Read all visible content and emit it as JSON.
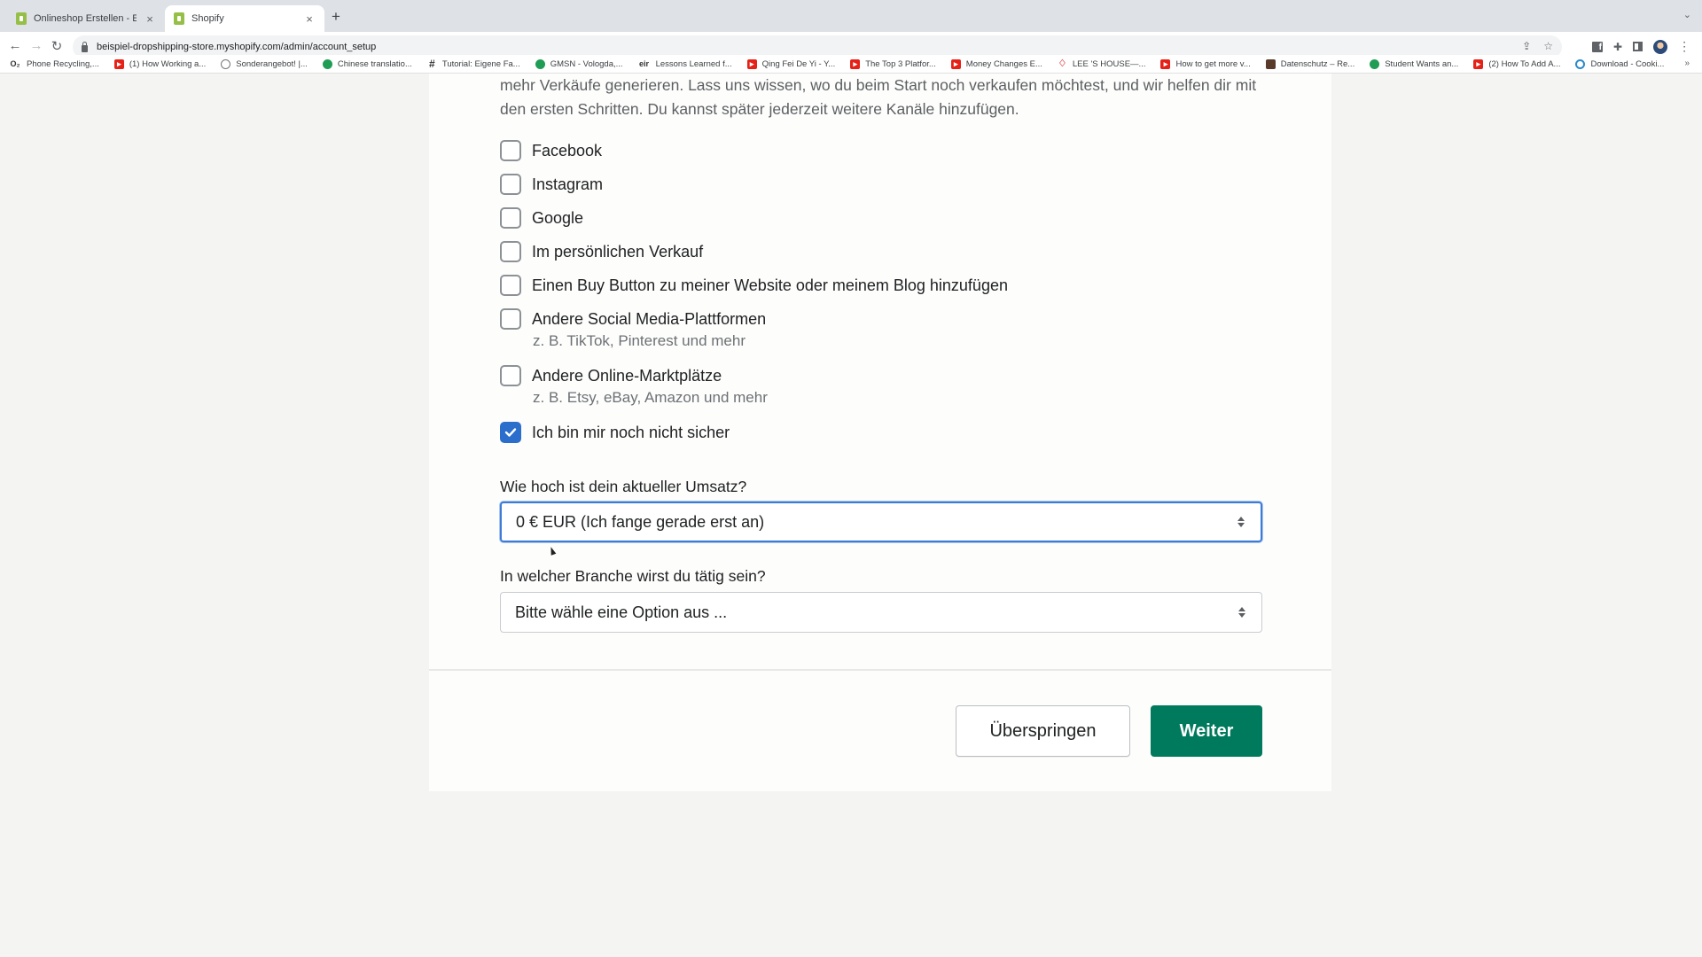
{
  "browser": {
    "tabs": [
      {
        "title": "Onlineshop Erstellen - Einfach",
        "active": false
      },
      {
        "title": "Shopify",
        "active": true
      }
    ],
    "new_tab_icon": "+",
    "close_icon": "×",
    "url": "beispiel-dropshipping-store.myshopify.com/admin/account_setup",
    "bookmarks": [
      {
        "label": "Phone Recycling,...",
        "icon": "o2-icon"
      },
      {
        "label": "(1) How Working a...",
        "icon": "youtube-icon"
      },
      {
        "label": "Sonderangebot! |...",
        "icon": "circle-check-icon"
      },
      {
        "label": "Chinese translatio...",
        "icon": "green-circle-icon"
      },
      {
        "label": "Tutorial: Eigene Fa...",
        "icon": "hash-icon"
      },
      {
        "label": "GMSN - Vologda,...",
        "icon": "upwork-icon"
      },
      {
        "label": "Lessons Learned f...",
        "icon": "text-logo-icon"
      },
      {
        "label": "Qing Fei De Yi - Y...",
        "icon": "youtube-icon"
      },
      {
        "label": "The Top 3 Platfor...",
        "icon": "youtube-icon"
      },
      {
        "label": "Money Changes E...",
        "icon": "youtube-icon"
      },
      {
        "label": "LEE 'S HOUSE—...",
        "icon": "airbnb-icon"
      },
      {
        "label": "How to get more v...",
        "icon": "youtube-icon"
      },
      {
        "label": "Datenschutz – Re...",
        "icon": "image-icon"
      },
      {
        "label": "Student Wants an...",
        "icon": "green-circle-icon"
      },
      {
        "label": "(2) How To Add A...",
        "icon": "youtube-icon"
      },
      {
        "label": "Download - Cooki...",
        "icon": "cookie-icon"
      }
    ],
    "bookmarks_overflow": "»"
  },
  "page": {
    "intro": "mehr Verkäufe generieren. Lass uns wissen, wo du beim Start noch verkaufen möchtest, und wir helfen dir mit den ersten Schritten. Du kannst später jederzeit weitere Kanäle hinzufügen.",
    "options": [
      {
        "label": "Facebook",
        "checked": false,
        "help": null
      },
      {
        "label": "Instagram",
        "checked": false,
        "help": null
      },
      {
        "label": "Google",
        "checked": false,
        "help": null
      },
      {
        "label": "Im persönlichen Verkauf",
        "checked": false,
        "help": null
      },
      {
        "label": "Einen Buy Button zu meiner Website oder meinem Blog hinzufügen",
        "checked": false,
        "help": null
      },
      {
        "label": "Andere Social Media-Plattformen",
        "checked": false,
        "help": "z. B. TikTok, Pinterest und mehr"
      },
      {
        "label": "Andere Online-Marktplätze",
        "checked": false,
        "help": "z. B. Etsy, eBay, Amazon und mehr"
      },
      {
        "label": "Ich bin mir noch nicht sicher",
        "checked": true,
        "help": null
      }
    ],
    "revenue": {
      "label": "Wie hoch ist dein aktueller Umsatz?",
      "value": "0 € EUR (Ich fange gerade erst an)"
    },
    "branche": {
      "label": "In welcher Branche wirst du tätig sein?",
      "placeholder": "Bitte wähle eine Option aus ..."
    },
    "buttons": {
      "skip": "Überspringen",
      "next": "Weiter"
    },
    "colors": {
      "primary": "#007a5c",
      "checkbox_checked": "#2c6ecb",
      "focus_ring": "#3d7bd6"
    }
  }
}
